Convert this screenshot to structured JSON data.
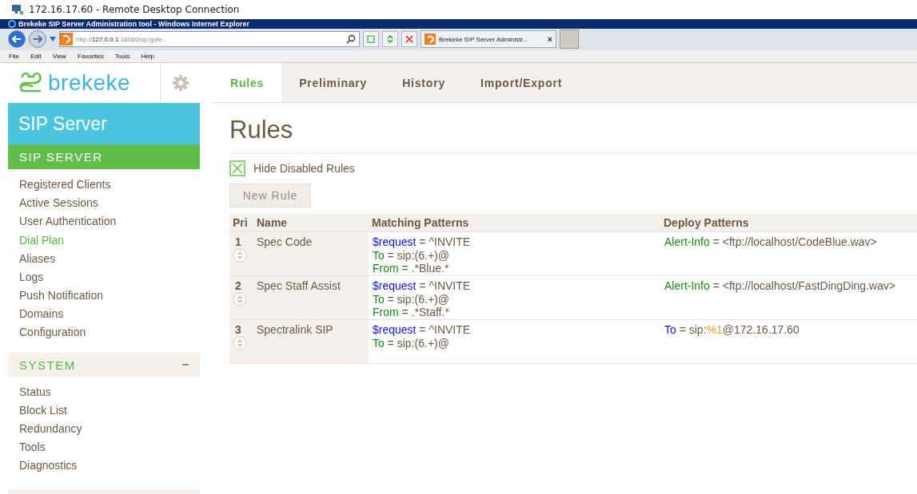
{
  "rdp_title": "172.16.17.60 - Remote Desktop Connection",
  "browser": {
    "title": "Brekeke SIP Server Administration tool - Windows Internet Explorer",
    "address": {
      "scheme": "http://",
      "host": "127.0.0.1",
      "rest": ":18080/sip/gate"
    },
    "tab": "Brekeke SIP Server Administr...",
    "tab_close": "×",
    "menu": [
      "File",
      "Edit",
      "View",
      "Favorites",
      "Tools",
      "Help"
    ]
  },
  "logo": "brekeke",
  "tabs": [
    {
      "label": "Rules",
      "selected": true
    },
    {
      "label": "Preliminary",
      "selected": false
    },
    {
      "label": "History",
      "selected": false
    },
    {
      "label": "Import/Export",
      "selected": false
    }
  ],
  "sidebar": {
    "product": "SIP Server",
    "sections": [
      {
        "title": "SIP SERVER",
        "items": [
          {
            "label": "Registered Clients",
            "selected": false
          },
          {
            "label": "Active Sessions",
            "selected": false
          },
          {
            "label": "User Authentication",
            "selected": false
          },
          {
            "label": "Dial Plan",
            "selected": true
          },
          {
            "label": "Aliases",
            "selected": false
          },
          {
            "label": "Logs",
            "selected": false
          },
          {
            "label": "Push Notification",
            "selected": false
          },
          {
            "label": "Domains",
            "selected": false
          },
          {
            "label": "Configuration",
            "selected": false
          }
        ]
      },
      {
        "title": "SYSTEM",
        "collapse": "−",
        "items": [
          {
            "label": "Status",
            "selected": false
          },
          {
            "label": "Block List",
            "selected": false
          },
          {
            "label": "Redundancy",
            "selected": false
          },
          {
            "label": "Tools",
            "selected": false
          },
          {
            "label": "Diagnostics",
            "selected": false
          }
        ]
      }
    ]
  },
  "page_title": "Rules",
  "hide_disabled": {
    "label": "Hide Disabled Rules",
    "checked": true
  },
  "new_rule": "New Rule",
  "table": {
    "columns": [
      "Pri",
      "Name",
      "Matching Patterns",
      "Deploy Patterns"
    ],
    "rows": [
      {
        "pri": "1",
        "name": "Spec Code",
        "matching": [
          [
            {
              "text": "$request",
              "color": "#1010ee"
            },
            {
              "text": " = ^INVITE",
              "color": "#6b5a45"
            }
          ],
          [
            {
              "text": "To",
              "color": "#1a8a1a"
            },
            {
              "text": " = sip:(6.+)@",
              "color": "#6b5a45"
            }
          ],
          [
            {
              "text": "From",
              "color": "#1a8a1a"
            },
            {
              "text": " = .*Blue.*",
              "color": "#6b5a45"
            }
          ]
        ],
        "deploy": [
          [
            {
              "text": "Alert-Info",
              "color": "#1a8a1a"
            },
            {
              "text": " = <ftp://localhost/CodeBlue.wav>",
              "color": "#6b5a45"
            }
          ]
        ]
      },
      {
        "pri": "2",
        "name": "Spec Staff Assist",
        "matching": [
          [
            {
              "text": "$request",
              "color": "#1010ee"
            },
            {
              "text": " = ^INVITE",
              "color": "#6b5a45"
            }
          ],
          [
            {
              "text": "To",
              "color": "#1a8a1a"
            },
            {
              "text": " = sip:(6.+)@",
              "color": "#6b5a45"
            }
          ],
          [
            {
              "text": "From",
              "color": "#1a8a1a"
            },
            {
              "text": " = .*Staff.*",
              "color": "#6b5a45"
            }
          ]
        ],
        "deploy": [
          [
            {
              "text": "Alert-Info",
              "color": "#1a8a1a"
            },
            {
              "text": " = <ftp://localhost/FastDingDing.wav>",
              "color": "#6b5a45"
            }
          ]
        ]
      },
      {
        "pri": "3",
        "name": "Spectralink SIP",
        "matching": [
          [
            {
              "text": "$request",
              "color": "#1010ee"
            },
            {
              "text": " = ^INVITE",
              "color": "#6b5a45"
            }
          ],
          [
            {
              "text": "To",
              "color": "#1a8a1a"
            },
            {
              "text": " = sip:(6.+)@",
              "color": "#6b5a45"
            }
          ]
        ],
        "deploy": [
          [
            {
              "text": "To",
              "color": "#1010ee"
            },
            {
              "text": " = sip:",
              "color": "#6b5a45"
            },
            {
              "text": "%1",
              "color": "#f0a020"
            },
            {
              "text": "@172.16.17.60",
              "color": "#6b5a45"
            }
          ]
        ]
      }
    ]
  }
}
